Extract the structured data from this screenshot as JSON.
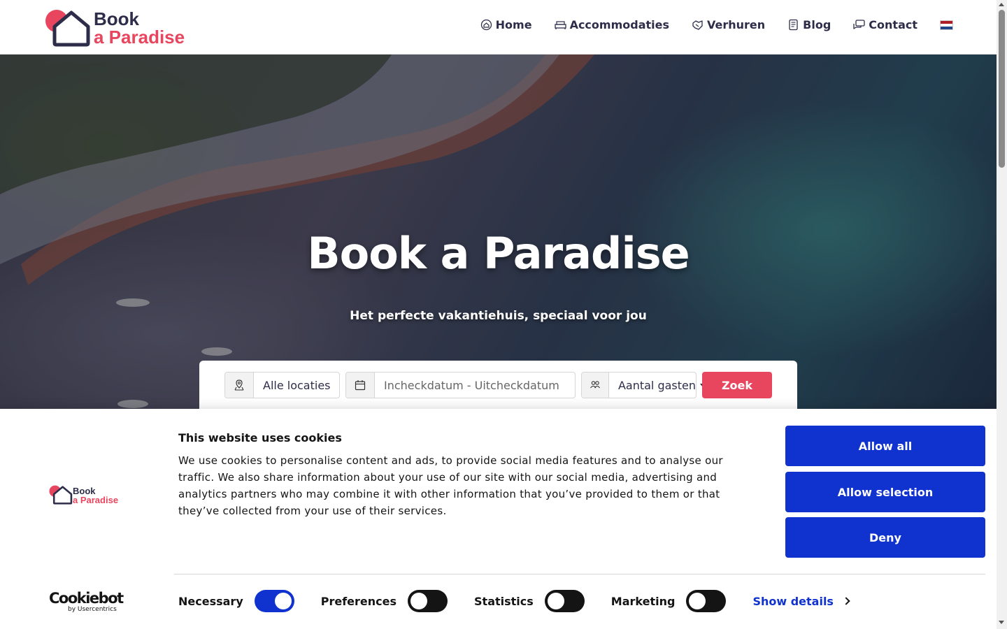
{
  "brand": {
    "line1": "Book",
    "line2": "a Paradise",
    "colors": {
      "dark": "#2d2d4a",
      "accent": "#e8455e"
    }
  },
  "nav": {
    "items": [
      {
        "label": "Home",
        "icon": "home-icon"
      },
      {
        "label": "Accommodaties",
        "icon": "bed-icon"
      },
      {
        "label": "Verhuren",
        "icon": "handshake-icon"
      },
      {
        "label": "Blog",
        "icon": "document-icon"
      },
      {
        "label": "Contact",
        "icon": "chat-icon"
      }
    ],
    "language_icon": "netherlands-flag-icon"
  },
  "hero": {
    "title": "Book a Paradise",
    "subtitle": "Het perfecte vakantiehuis, speciaal voor jou"
  },
  "search": {
    "location": {
      "value": "Alle locaties",
      "icon": "map-pin-icon"
    },
    "dates": {
      "placeholder": "Incheckdatum - Uitcheckdatum",
      "icon": "calendar-icon"
    },
    "guests": {
      "value": "Aantal gasten",
      "icon": "users-icon"
    },
    "submit_label": "Zoek"
  },
  "cookie_banner": {
    "title": "This website uses cookies",
    "body": "We use cookies to personalise content and ads, to provide social media features and to analyse our traffic. We also share information about your use of our site with our social media, advertising and analytics partners who may combine it with other information that you’ve provided to them or that they’ve collected from your use of their services.",
    "buttons": {
      "allow_all": "Allow all",
      "allow_selection": "Allow selection",
      "deny": "Deny"
    },
    "toggles": [
      {
        "label": "Necessary",
        "on": true
      },
      {
        "label": "Preferences",
        "on": false
      },
      {
        "label": "Statistics",
        "on": false
      },
      {
        "label": "Marketing",
        "on": false
      }
    ],
    "show_details": "Show details",
    "provider": {
      "name": "Cookiebot",
      "byline": "by Usercentrics"
    },
    "button_color": "#1032cf"
  }
}
